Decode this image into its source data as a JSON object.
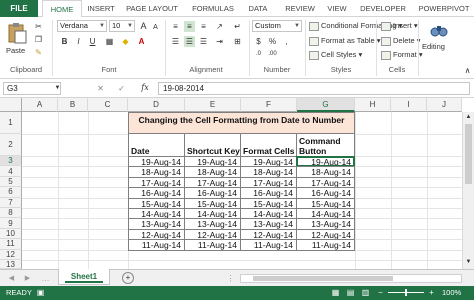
{
  "tabs": {
    "file": "FILE",
    "items": [
      "HOME",
      "INSERT",
      "PAGE LAYOUT",
      "FORMULAS",
      "DATA",
      "REVIEW",
      "VIEW",
      "DEVELOPER",
      "POWERPIVOT"
    ],
    "active": "HOME"
  },
  "ribbon": {
    "clipboard": {
      "paste": "Paste",
      "label": "Clipboard"
    },
    "font": {
      "name": "Verdana",
      "size": "10",
      "label": "Font",
      "bold": "B",
      "italic": "I",
      "underline": "U",
      "grow": "A",
      "shrink": "A"
    },
    "alignment": {
      "label": "Alignment"
    },
    "number": {
      "format": "Custom",
      "currency": "$",
      "percent": "%",
      "comma": ",",
      "label": "Number"
    },
    "styles": {
      "conditional": "Conditional Formatting",
      "format_table": "Format as Table",
      "cell_styles": "Cell Styles",
      "label": "Styles"
    },
    "cells": {
      "insert": "Insert",
      "delete": "Delete",
      "format": "Format",
      "label": "Cells"
    },
    "editing": {
      "label": "Editing"
    }
  },
  "formula_bar": {
    "name_box": "G3",
    "formula": "19-08-2014",
    "cancel": "✕",
    "enter": "✓",
    "fx": "fx"
  },
  "columns": [
    "A",
    "B",
    "C",
    "D",
    "E",
    "F",
    "G",
    "H",
    "I",
    "J"
  ],
  "rows": [
    "1",
    "2",
    "3",
    "4",
    "5",
    "6",
    "7",
    "8",
    "9",
    "10",
    "11",
    "12",
    "13"
  ],
  "table": {
    "title": "Changing the Cell Formatting from Date to Number",
    "headers": [
      "Date",
      "Shortcut Key",
      "Format Cells",
      "Command Button"
    ],
    "rows": [
      [
        "19-Aug-14",
        "19-Aug-14",
        "19-Aug-14",
        "19-Aug-14"
      ],
      [
        "18-Aug-14",
        "18-Aug-14",
        "18-Aug-14",
        "18-Aug-14"
      ],
      [
        "17-Aug-14",
        "17-Aug-14",
        "17-Aug-14",
        "17-Aug-14"
      ],
      [
        "16-Aug-14",
        "16-Aug-14",
        "16-Aug-14",
        "16-Aug-14"
      ],
      [
        "15-Aug-14",
        "15-Aug-14",
        "15-Aug-14",
        "15-Aug-14"
      ],
      [
        "14-Aug-14",
        "14-Aug-14",
        "14-Aug-14",
        "14-Aug-14"
      ],
      [
        "13-Aug-14",
        "13-Aug-14",
        "13-Aug-14",
        "13-Aug-14"
      ],
      [
        "12-Aug-14",
        "12-Aug-14",
        "12-Aug-14",
        "12-Aug-14"
      ],
      [
        "11-Aug-14",
        "11-Aug-14",
        "11-Aug-14",
        "11-Aug-14"
      ]
    ]
  },
  "sheets": {
    "active": "Sheet1",
    "add": "+"
  },
  "status": {
    "mode": "READY",
    "zoom": "100%",
    "zoom_minus": "−",
    "zoom_plus": "+"
  },
  "colors": {
    "accent": "#217346",
    "title_fill": "#fce4d6"
  }
}
